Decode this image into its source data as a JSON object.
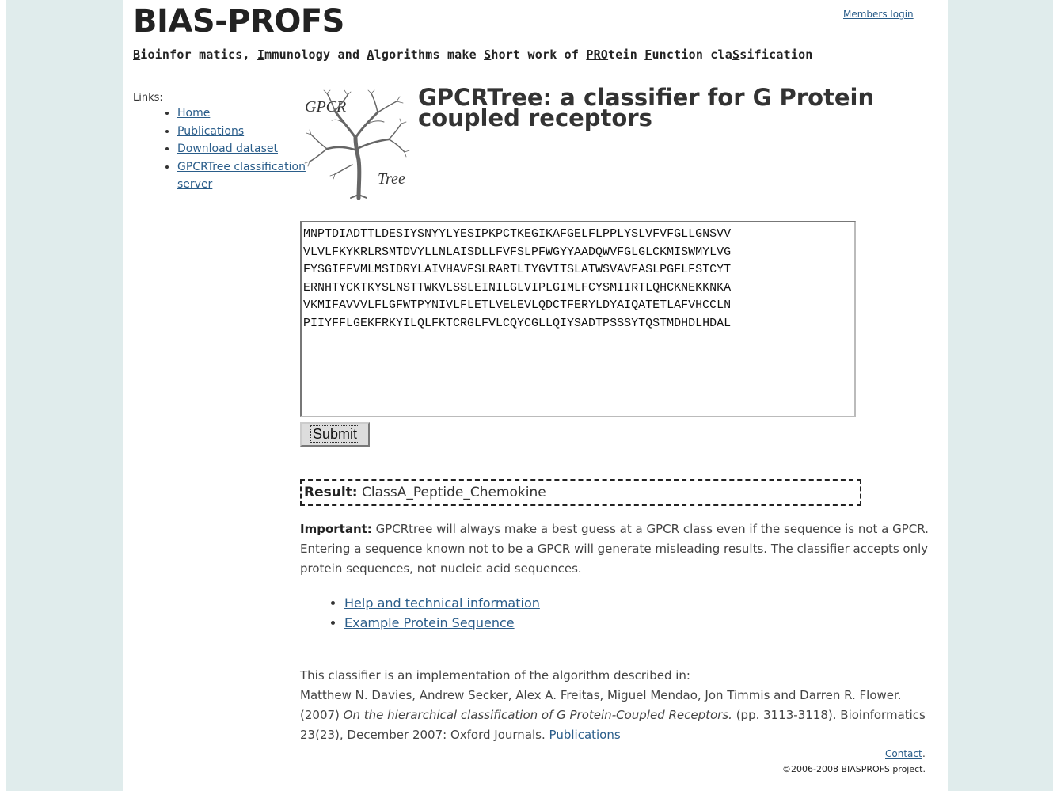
{
  "header": {
    "site_title": "BIAS-PROFS",
    "members_login": "Members login",
    "tagline_parts": [
      {
        "t": "B",
        "u": true
      },
      {
        "t": "ioinfor matics, ",
        "u": false
      },
      {
        "t": "I",
        "u": true
      },
      {
        "t": "mmunology and ",
        "u": false
      },
      {
        "t": "A",
        "u": true
      },
      {
        "t": "lgorithms make ",
        "u": false
      },
      {
        "t": "S",
        "u": true
      },
      {
        "t": "hort work of ",
        "u": false
      },
      {
        "t": "PRO",
        "u": true
      },
      {
        "t": "tein ",
        "u": false
      },
      {
        "t": "F",
        "u": true
      },
      {
        "t": "unction cla",
        "u": false
      },
      {
        "t": "S",
        "u": true
      },
      {
        "t": "sification",
        "u": false
      }
    ]
  },
  "sidebar": {
    "label": "Links:",
    "items": [
      {
        "label": "Home"
      },
      {
        "label": "Publications"
      },
      {
        "label": "Download dataset"
      },
      {
        "label": "GPCRTree classification server"
      }
    ]
  },
  "logo": {
    "top_text": "GPCR",
    "bottom_text": "Tree",
    "icon": "tree-icon"
  },
  "main": {
    "heading": "GPCRTree: a classifier for G Protein coupled receptors",
    "sequence": "MNPTDIADTTLDESIYSNYYLYESIPKPCTKEGIKAFGELFLPPLYSLVFVFGLLGNSVV\nVLVLFKYKRLRSMTDVYLLNLAISDLLFVFSLPFWGYYAADQWVFGLGLCKMISWMYLVG\nFYSGIFFVMLMSIDRYLAIVHAVFSLRARTLTYGVITSLATWSVAVFASLPGFLFSTCYT\nERNHTYCKTKYSLNSTTWKVLSSLEINILGLVIPLGIMLFCYSMIIRTLQHCKNEKKNKA\nVKMIFAVVVLFLGFWTPYNIVLFLETLVELEVLQDCTFERYLDYAIQATETLAFVHCCLN\nPIIYFFLGEKFRKYILQLFKTCRGLFVLCQYCGLLQIYSADTPSSSYTQSTMDHDLHDAL",
    "submit_label": "Submit",
    "result_label": "Result:",
    "result_value": "ClassA_Peptide_Chemokine",
    "important_label": "Important:",
    "important_text": "GPCRtree will always make a best guess at a GPCR class even if the sequence is not a GPCR. Entering a sequence known not to be a GPCR will generate misleading results. The classifier accepts only protein sequences, not nucleic acid sequences.",
    "help_links": [
      {
        "label": "Help and technical information"
      },
      {
        "label": "Example Protein Sequence"
      }
    ],
    "reference_intro": "This classifier is an implementation of the algorithm described in:",
    "reference_authors": "Matthew N. Davies, Andrew Secker, Alex A. Freitas, Miguel Mendao, Jon Timmis and Darren R. Flower.",
    "reference_year": "(2007)",
    "reference_title": "On the hierarchical classification of G Protein-Coupled Receptors.",
    "reference_rest": "(pp. 3113-3118). Bioinformatics 23(23), December 2007: Oxford Journals.",
    "reference_link": "Publications"
  },
  "footer": {
    "contact": "Contact",
    "copyright": "©2006-2008 BIASPROFS project."
  }
}
